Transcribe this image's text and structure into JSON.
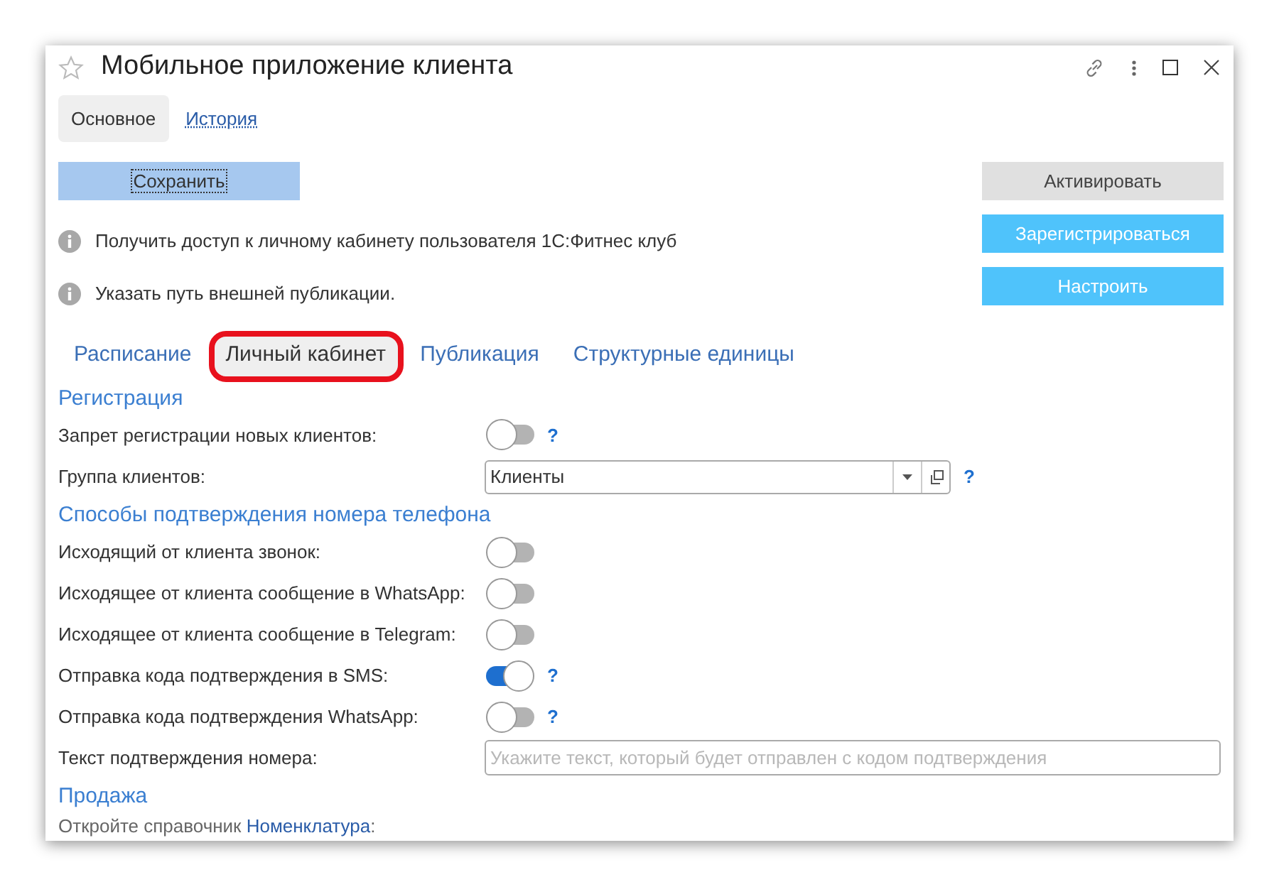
{
  "window": {
    "title": "Мобильное приложение клиента"
  },
  "tabs": [
    {
      "label": "Основное",
      "selected": true
    },
    {
      "label": "История",
      "selected": false
    }
  ],
  "save_button": "Сохранить",
  "side_buttons": [
    {
      "label": "Активировать",
      "kind": "secondary"
    },
    {
      "label": "Зарегистрироваться",
      "kind": "primary"
    },
    {
      "label": "Настроить",
      "kind": "primary"
    }
  ],
  "info_lines": [
    "Получить доступ к личному кабинету пользователя 1С:Фитнес клуб",
    "Указать путь внешней публикации."
  ],
  "section_tabs": [
    {
      "label": "Расписание",
      "selected": false,
      "highlighted": false
    },
    {
      "label": "Личный кабинет",
      "selected": true,
      "highlighted": true
    },
    {
      "label": "Публикация",
      "selected": false,
      "highlighted": false
    },
    {
      "label": "Структурные единицы",
      "selected": false,
      "highlighted": false
    }
  ],
  "groups": [
    {
      "heading": "Регистрация",
      "fields": [
        {
          "kind": "toggle",
          "label": "Запрет регистрации новых клиентов:",
          "on": false,
          "help": "?"
        },
        {
          "kind": "select",
          "label": "Группа клиентов:",
          "value": "Клиенты",
          "help": "?"
        }
      ]
    },
    {
      "heading": "Способы подтверждения номера телефона",
      "fields": [
        {
          "kind": "toggle",
          "label": "Исходящий от клиента звонок:",
          "on": false
        },
        {
          "kind": "toggle",
          "label": "Исходящее от клиента сообщение в WhatsApp:",
          "on": false
        },
        {
          "kind": "toggle",
          "label": "Исходящее от клиента сообщение в Telegram:",
          "on": false
        },
        {
          "kind": "toggle",
          "label": "Отправка кода подтверждения в SMS:",
          "on": true,
          "help": "?"
        },
        {
          "kind": "toggle",
          "label": "Отправка кода подтверждения WhatsApp:",
          "on": false,
          "help": "?"
        },
        {
          "kind": "text",
          "label": "Текст подтверждения номера:",
          "placeholder": "Укажите текст, который будет отправлен с кодом подтверждения"
        }
      ]
    },
    {
      "heading": "Продажа",
      "fields": [
        {
          "kind": "note",
          "text": "Откройте справочник ",
          "link": "Номенклатура",
          "after": ":"
        }
      ]
    }
  ]
}
